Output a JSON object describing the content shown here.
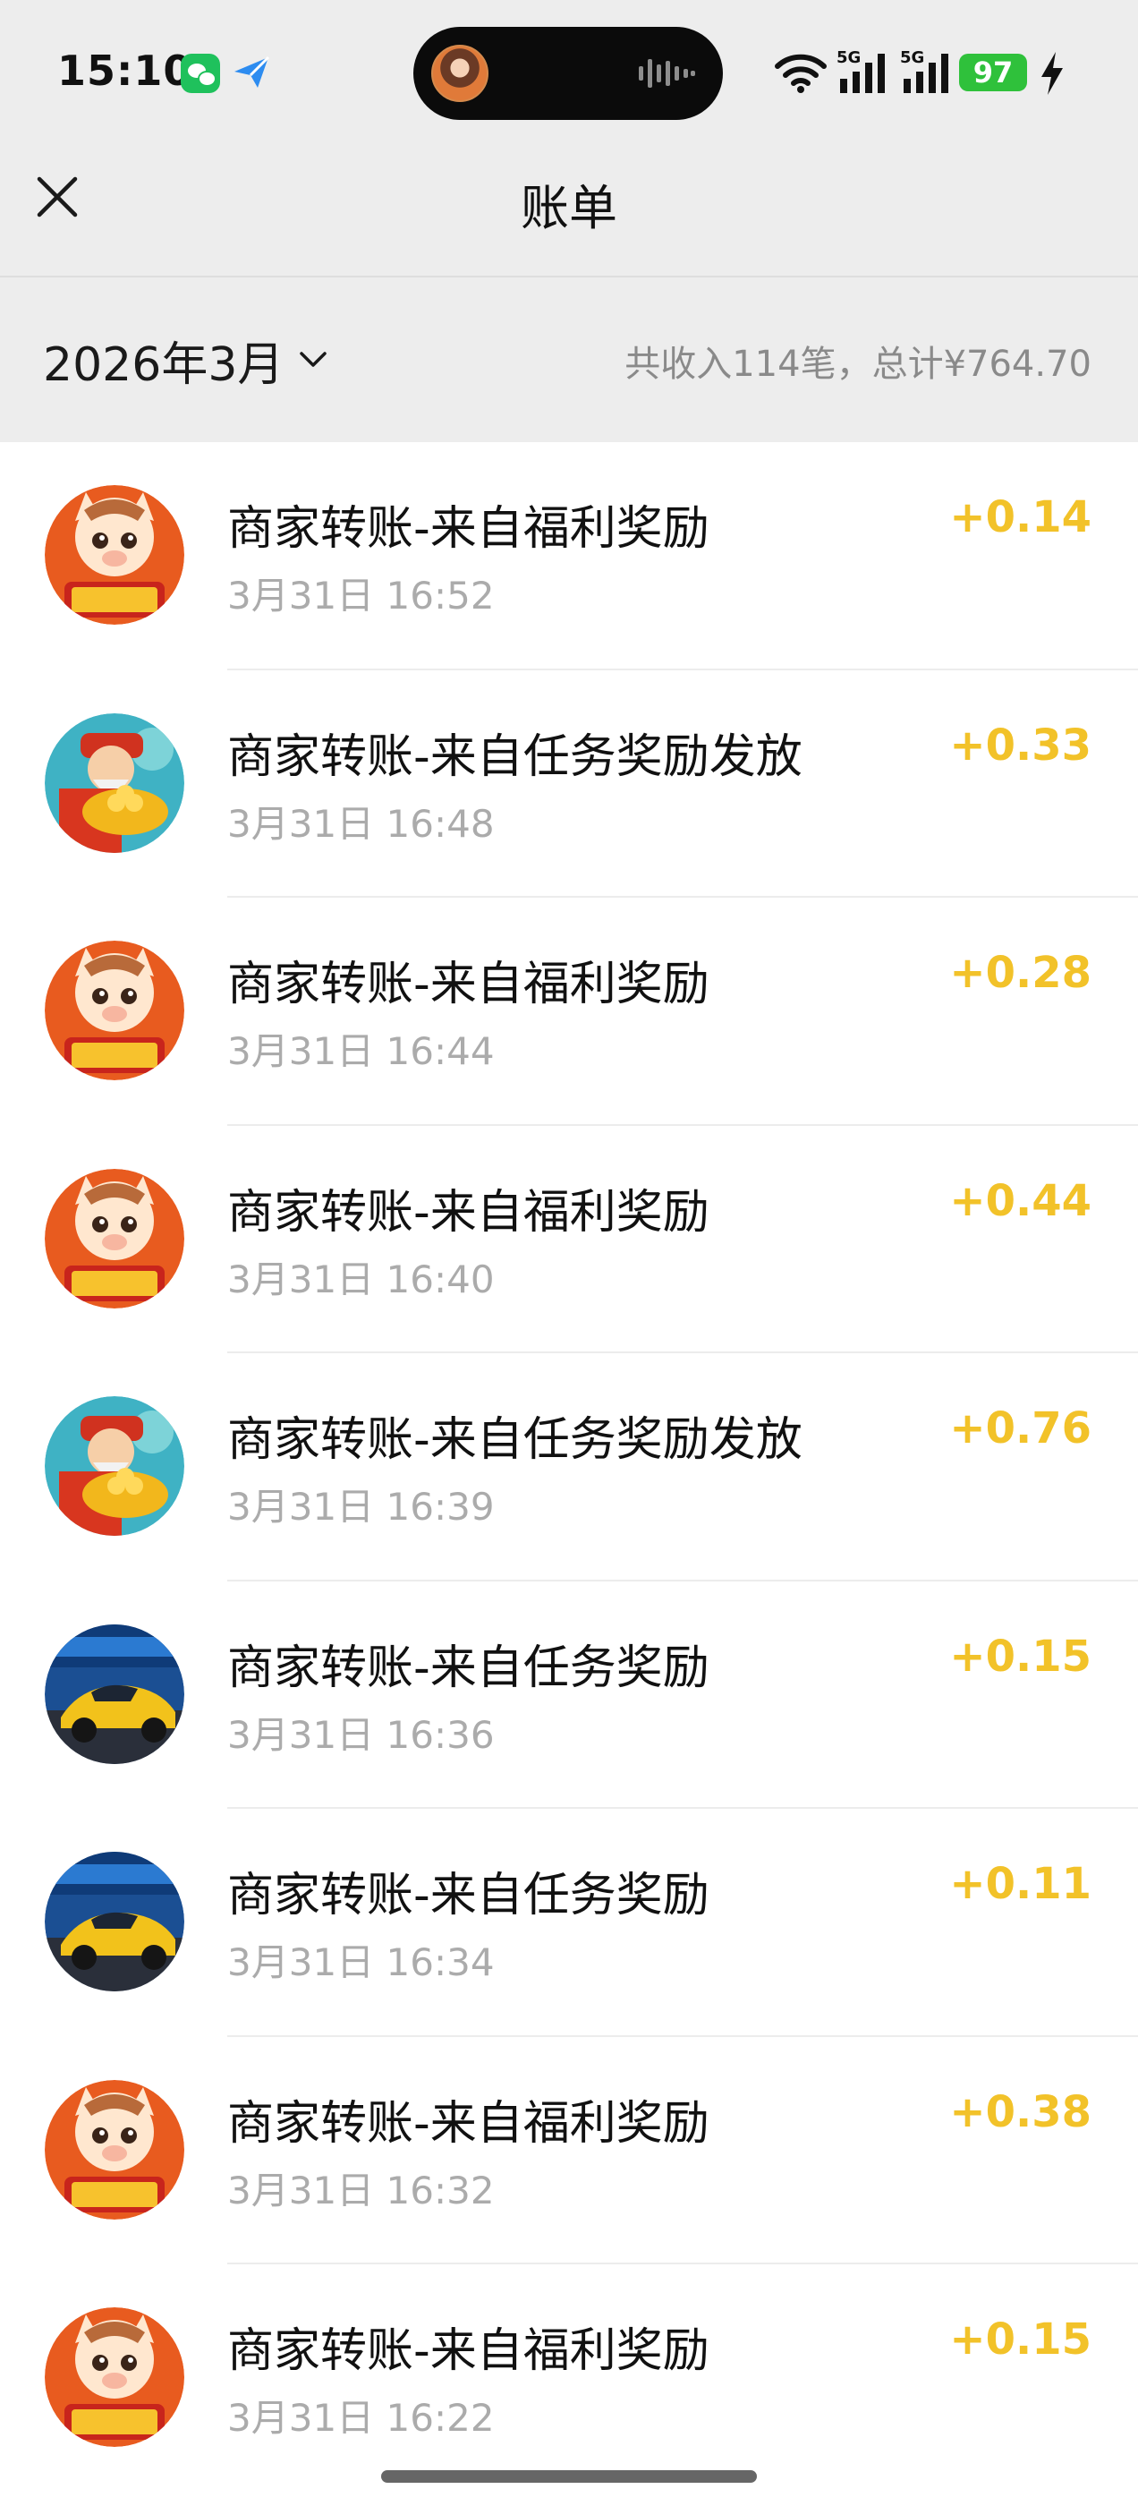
{
  "status_bar": {
    "time": "15:10",
    "network_labels": [
      "5G",
      "5G"
    ],
    "battery": "97",
    "icons": [
      "wechat-icon",
      "send-icon",
      "wifi-icon",
      "signal-icon",
      "signal-icon",
      "battery-icon",
      "charging-icon"
    ]
  },
  "header": {
    "title": "账单",
    "close_icon": "close-icon"
  },
  "summary": {
    "month": "2026年3月",
    "summary_text": "共收入114笔，总计¥764.70"
  },
  "colors": {
    "amount": "#f2c229",
    "background": "#ededed",
    "battery": "#2fc13b"
  },
  "transactions": [
    {
      "avatar": "horse-fortune-avatar",
      "title": "商家转账-来自福利奖励",
      "time": "3月31日 16:52",
      "amount": "+0.14"
    },
    {
      "avatar": "fortune-god-avatar",
      "title": "商家转账-来自任务奖励发放",
      "time": "3月31日 16:48",
      "amount": "+0.33"
    },
    {
      "avatar": "horse-fortune-avatar",
      "title": "商家转账-来自福利奖励",
      "time": "3月31日 16:44",
      "amount": "+0.28"
    },
    {
      "avatar": "horse-fortune-avatar",
      "title": "商家转账-来自福利奖励",
      "time": "3月31日 16:40",
      "amount": "+0.44"
    },
    {
      "avatar": "fortune-god-avatar",
      "title": "商家转账-来自任务奖励发放",
      "time": "3月31日 16:39",
      "amount": "+0.76"
    },
    {
      "avatar": "sports-car-avatar",
      "title": "商家转账-来自任务奖励",
      "time": "3月31日 16:36",
      "amount": "+0.15"
    },
    {
      "avatar": "sports-car-avatar",
      "title": "商家转账-来自任务奖励",
      "time": "3月31日 16:34",
      "amount": "+0.11"
    },
    {
      "avatar": "horse-fortune-avatar",
      "title": "商家转账-来自福利奖励",
      "time": "3月31日 16:32",
      "amount": "+0.38"
    },
    {
      "avatar": "horse-fortune-avatar",
      "title": "商家转账-来自福利奖励",
      "time": "3月31日 16:22",
      "amount": "+0.15"
    }
  ]
}
